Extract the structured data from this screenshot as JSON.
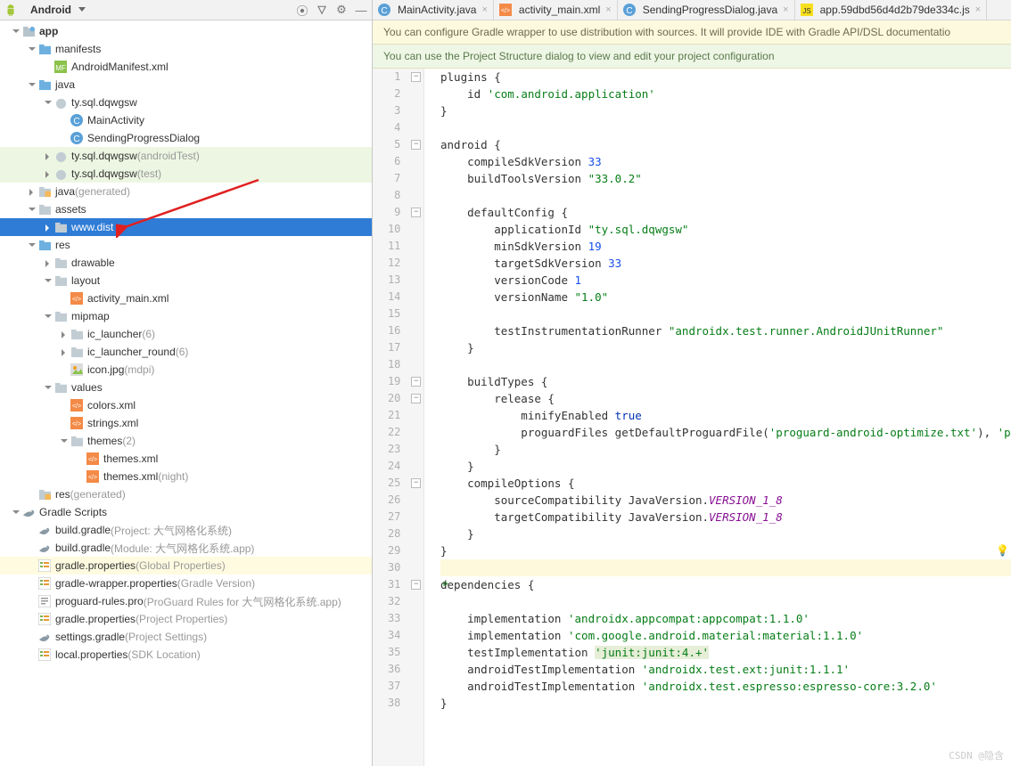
{
  "left_header": {
    "title": "Android"
  },
  "tree": [
    {
      "d": 0,
      "exp": "down",
      "icon": "module",
      "label": "app",
      "bold": true
    },
    {
      "d": 1,
      "exp": "down",
      "icon": "folder-blue",
      "label": "manifests"
    },
    {
      "d": 2,
      "icon": "manifest",
      "label": "AndroidManifest.xml"
    },
    {
      "d": 1,
      "exp": "down",
      "icon": "folder-blue",
      "label": "java"
    },
    {
      "d": 2,
      "exp": "down",
      "icon": "package",
      "label": "ty.sql.dqwgsw"
    },
    {
      "d": 3,
      "icon": "class",
      "label": "MainActivity"
    },
    {
      "d": 3,
      "icon": "class",
      "label": "SendingProgressDialog"
    },
    {
      "d": 2,
      "exp": "right",
      "icon": "package",
      "label": "ty.sql.dqwgsw",
      "suffix": " (androidTest)",
      "hl": "green"
    },
    {
      "d": 2,
      "exp": "right",
      "icon": "package",
      "label": "ty.sql.dqwgsw",
      "suffix": " (test)",
      "hl": "green"
    },
    {
      "d": 1,
      "exp": "right",
      "icon": "folder-gen",
      "label": "java",
      "suffix": " (generated)"
    },
    {
      "d": 1,
      "exp": "down",
      "icon": "folder",
      "label": "assets"
    },
    {
      "d": 2,
      "exp": "right",
      "icon": "folder",
      "label": "www.dist",
      "selected": true
    },
    {
      "d": 1,
      "exp": "down",
      "icon": "folder-blue",
      "label": "res"
    },
    {
      "d": 2,
      "exp": "right",
      "icon": "folder",
      "label": "drawable"
    },
    {
      "d": 2,
      "exp": "down",
      "icon": "folder",
      "label": "layout"
    },
    {
      "d": 3,
      "icon": "xml",
      "label": "activity_main.xml"
    },
    {
      "d": 2,
      "exp": "down",
      "icon": "folder",
      "label": "mipmap"
    },
    {
      "d": 3,
      "exp": "right",
      "icon": "folder",
      "label": "ic_launcher",
      "suffix": " (6)"
    },
    {
      "d": 3,
      "exp": "right",
      "icon": "folder",
      "label": "ic_launcher_round",
      "suffix": " (6)"
    },
    {
      "d": 3,
      "icon": "image",
      "label": "icon.jpg",
      "suffix": " (mdpi)"
    },
    {
      "d": 2,
      "exp": "down",
      "icon": "folder",
      "label": "values"
    },
    {
      "d": 3,
      "icon": "xml",
      "label": "colors.xml"
    },
    {
      "d": 3,
      "icon": "xml",
      "label": "strings.xml"
    },
    {
      "d": 3,
      "exp": "down",
      "icon": "folder",
      "label": "themes",
      "suffix": " (2)"
    },
    {
      "d": 4,
      "icon": "xml",
      "label": "themes.xml"
    },
    {
      "d": 4,
      "icon": "xml",
      "label": "themes.xml",
      "suffix": " (night)"
    },
    {
      "d": 1,
      "icon": "folder-gen",
      "label": "res",
      "suffix": " (generated)"
    },
    {
      "d": 0,
      "exp": "down",
      "icon": "gradle",
      "label": "Gradle Scripts"
    },
    {
      "d": 1,
      "icon": "gradle-file",
      "label": "build.gradle",
      "suffix": " (Project: 大气网格化系统)"
    },
    {
      "d": 1,
      "icon": "gradle-file",
      "label": "build.gradle",
      "suffix": " (Module: 大气网格化系统.app)"
    },
    {
      "d": 1,
      "icon": "prop",
      "label": "gradle.properties",
      "suffix": " (Global Properties)",
      "hl": "yellow"
    },
    {
      "d": 1,
      "icon": "prop",
      "label": "gradle-wrapper.properties",
      "suffix": " (Gradle Version)"
    },
    {
      "d": 1,
      "icon": "text",
      "label": "proguard-rules.pro",
      "suffix": " (ProGuard Rules for 大气网格化系统.app)"
    },
    {
      "d": 1,
      "icon": "prop",
      "label": "gradle.properties",
      "suffix": " (Project Properties)"
    },
    {
      "d": 1,
      "icon": "gradle-file",
      "label": "settings.gradle",
      "suffix": " (Project Settings)"
    },
    {
      "d": 1,
      "icon": "prop",
      "label": "local.properties",
      "suffix": " (SDK Location)"
    }
  ],
  "tabs": [
    {
      "icon": "class",
      "label": "MainActivity.java"
    },
    {
      "icon": "xml",
      "label": "activity_main.xml"
    },
    {
      "icon": "class",
      "label": "SendingProgressDialog.java"
    },
    {
      "icon": "js",
      "label": "app.59dbd56d4d2b79de334c.js"
    }
  ],
  "banners": {
    "warn": "You can configure Gradle wrapper to use distribution with sources. It will provide IDE with Gradle API/DSL documentatio",
    "info": "You can use the Project Structure dialog to view and edit your project configuration"
  },
  "code": [
    {
      "n": 1,
      "t": [
        "plugins {"
      ]
    },
    {
      "n": 2,
      "t": [
        "    id ",
        "'com.android.application'"
      ],
      "cls": [
        "",
        "str"
      ]
    },
    {
      "n": 3,
      "t": [
        "}"
      ]
    },
    {
      "n": 4,
      "t": [
        ""
      ]
    },
    {
      "n": 5,
      "t": [
        "android {"
      ]
    },
    {
      "n": 6,
      "t": [
        "    compileSdkVersion ",
        "33"
      ],
      "cls": [
        "",
        "num"
      ]
    },
    {
      "n": 7,
      "t": [
        "    buildToolsVersion ",
        "\"33.0.2\""
      ],
      "cls": [
        "",
        "str"
      ]
    },
    {
      "n": 8,
      "t": [
        ""
      ]
    },
    {
      "n": 9,
      "t": [
        "    defaultConfig {"
      ]
    },
    {
      "n": 10,
      "t": [
        "        applicationId ",
        "\"ty.sql.dqwgsw\""
      ],
      "cls": [
        "",
        "str"
      ]
    },
    {
      "n": 11,
      "t": [
        "        minSdkVersion ",
        "19"
      ],
      "cls": [
        "",
        "num"
      ]
    },
    {
      "n": 12,
      "t": [
        "        targetSdkVersion ",
        "33"
      ],
      "cls": [
        "",
        "num"
      ]
    },
    {
      "n": 13,
      "t": [
        "        versionCode ",
        "1"
      ],
      "cls": [
        "",
        "num"
      ]
    },
    {
      "n": 14,
      "t": [
        "        versionName ",
        "\"1.0\""
      ],
      "cls": [
        "",
        "str"
      ]
    },
    {
      "n": 15,
      "t": [
        ""
      ]
    },
    {
      "n": 16,
      "t": [
        "        testInstrumentationRunner ",
        "\"androidx.test.runner.AndroidJUnitRunner\""
      ],
      "cls": [
        "",
        "str"
      ]
    },
    {
      "n": 17,
      "t": [
        "    }"
      ]
    },
    {
      "n": 18,
      "t": [
        ""
      ]
    },
    {
      "n": 19,
      "t": [
        "    buildTypes {"
      ]
    },
    {
      "n": 20,
      "t": [
        "        release {"
      ]
    },
    {
      "n": 21,
      "t": [
        "            minifyEnabled ",
        "true"
      ],
      "cls": [
        "",
        "kw"
      ]
    },
    {
      "n": 22,
      "t": [
        "            proguardFiles getDefaultProguardFile(",
        "'proguard-android-optimize.txt'",
        "), ",
        "'proguard-"
      ],
      "cls": [
        "",
        "str",
        "",
        "str"
      ]
    },
    {
      "n": 23,
      "t": [
        "        }"
      ]
    },
    {
      "n": 24,
      "t": [
        "    }"
      ]
    },
    {
      "n": 25,
      "t": [
        "    compileOptions {"
      ]
    },
    {
      "n": 26,
      "t": [
        "        sourceCompatibility JavaVersion.",
        "VERSION_1_8"
      ],
      "cls": [
        "",
        "id"
      ]
    },
    {
      "n": 27,
      "t": [
        "        targetCompatibility JavaVersion.",
        "VERSION_1_8"
      ],
      "cls": [
        "",
        "id"
      ]
    },
    {
      "n": 28,
      "t": [
        "    }"
      ]
    },
    {
      "n": 29,
      "t": [
        "}"
      ],
      "bulb": true
    },
    {
      "n": 30,
      "t": [
        ""
      ],
      "hl": true
    },
    {
      "n": 31,
      "t": [
        "dependencies {"
      ],
      "run": true
    },
    {
      "n": 32,
      "t": [
        ""
      ]
    },
    {
      "n": 33,
      "t": [
        "    implementation ",
        "'androidx.appcompat:appcompat:1.1.0'"
      ],
      "cls": [
        "",
        "str"
      ]
    },
    {
      "n": 34,
      "t": [
        "    implementation ",
        "'com.google.android.material:material:1.1.0'"
      ],
      "cls": [
        "",
        "str"
      ]
    },
    {
      "n": 35,
      "t": [
        "    testImplementation ",
        "'junit:junit:4.+'"
      ],
      "cls": [
        "",
        "str emph"
      ]
    },
    {
      "n": 36,
      "t": [
        "    androidTestImplementation ",
        "'androidx.test.ext:junit:1.1.1'"
      ],
      "cls": [
        "",
        "str"
      ]
    },
    {
      "n": 37,
      "t": [
        "    androidTestImplementation ",
        "'androidx.test.espresso:espresso-core:3.2.0'"
      ],
      "cls": [
        "",
        "str"
      ]
    },
    {
      "n": 38,
      "t": [
        "}"
      ]
    }
  ],
  "watermark": "CSDN @隐含"
}
